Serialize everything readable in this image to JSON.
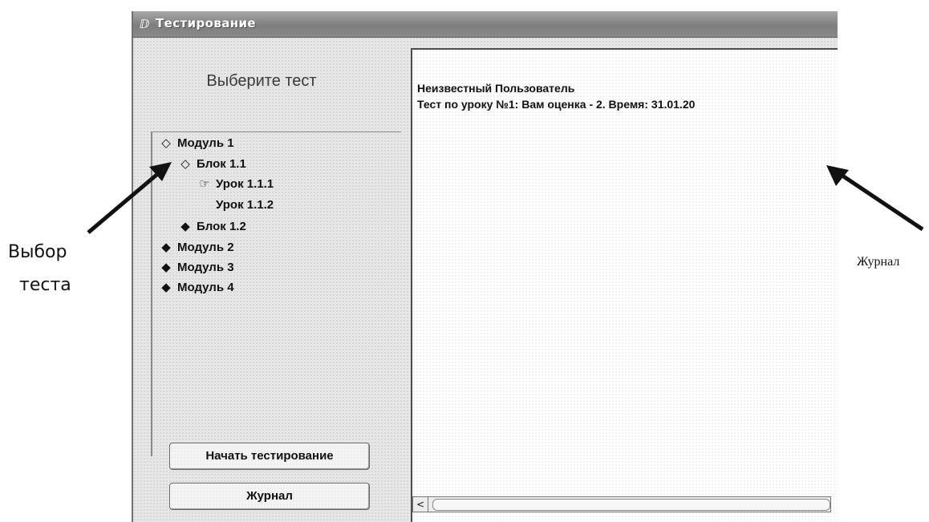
{
  "window": {
    "title": "Тестирование"
  },
  "left_pane": {
    "heading": "Выберите тест",
    "tree": [
      {
        "label": "Модуль 1",
        "icon": "open-book-icon",
        "icon_glyph": "◇"
      },
      {
        "label": "Блок 1.1",
        "icon": "open-book-icon",
        "icon_glyph": "◇"
      },
      {
        "label": "Урок 1.1.1",
        "icon": "pointing-hand-icon",
        "icon_glyph": "☞"
      },
      {
        "label": "Урок 1.1.2",
        "icon": "",
        "icon_glyph": ""
      },
      {
        "label": "Блок 1.2",
        "icon": "closed-book-icon",
        "icon_glyph": "◆"
      },
      {
        "label": "Модуль 2",
        "icon": "closed-book-icon",
        "icon_glyph": "◆"
      },
      {
        "label": "Модуль 3",
        "icon": "closed-book-icon",
        "icon_glyph": "◆"
      },
      {
        "label": "Модуль 4",
        "icon": "closed-book-icon",
        "icon_glyph": "◆"
      }
    ],
    "start_button": "Начать тестирование",
    "journal_button": "Журнал"
  },
  "log": {
    "lines": [
      "Неизвестный Пользователь",
      "Тест по уроку №1:  Вам оценка - 2. Время: 31.01.20"
    ],
    "scroll_left_glyph": "<"
  },
  "annotations": {
    "left_label_line1": "Выбор",
    "left_label_line2": "теста",
    "right_label": "Журнал"
  }
}
